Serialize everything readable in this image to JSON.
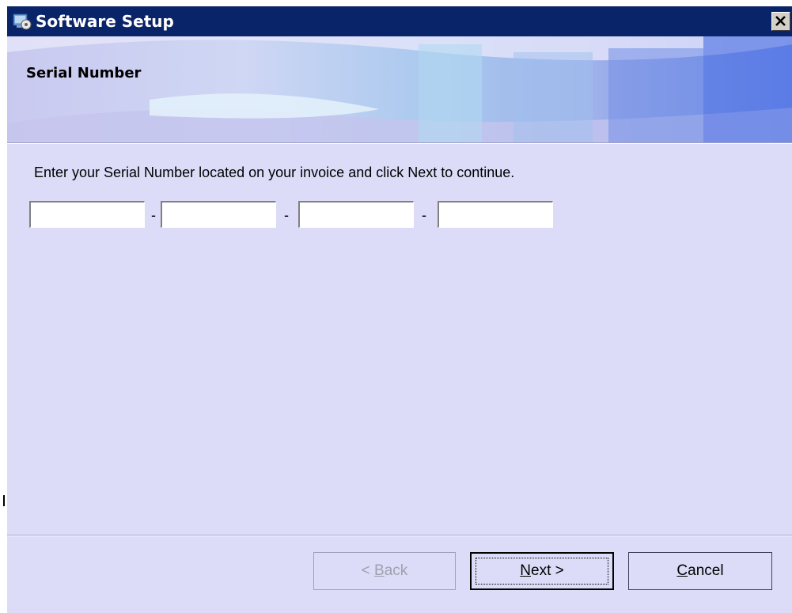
{
  "window": {
    "title": "Software Setup",
    "icon": "setup-package-icon"
  },
  "banner": {
    "title": "Serial Number"
  },
  "instruction": "Enter your Serial Number located on your invoice and click Next to continue.",
  "serial": {
    "fields": [
      {
        "value": "",
        "placeholder": ""
      },
      {
        "value": "",
        "placeholder": ""
      },
      {
        "value": "",
        "placeholder": ""
      },
      {
        "value": "",
        "placeholder": ""
      }
    ],
    "separator": "-"
  },
  "buttons": {
    "back": {
      "label": "< Back",
      "mnemonic": "B",
      "enabled": false
    },
    "next": {
      "label": "Next >",
      "mnemonic": "N",
      "enabled": true
    },
    "cancel": {
      "label": "Cancel",
      "mnemonic": "C",
      "enabled": true
    }
  },
  "colors": {
    "titlebar": "#0a246a",
    "dialog_bg": "#dcdcf8",
    "banner_accent": "#5b7ce6"
  }
}
